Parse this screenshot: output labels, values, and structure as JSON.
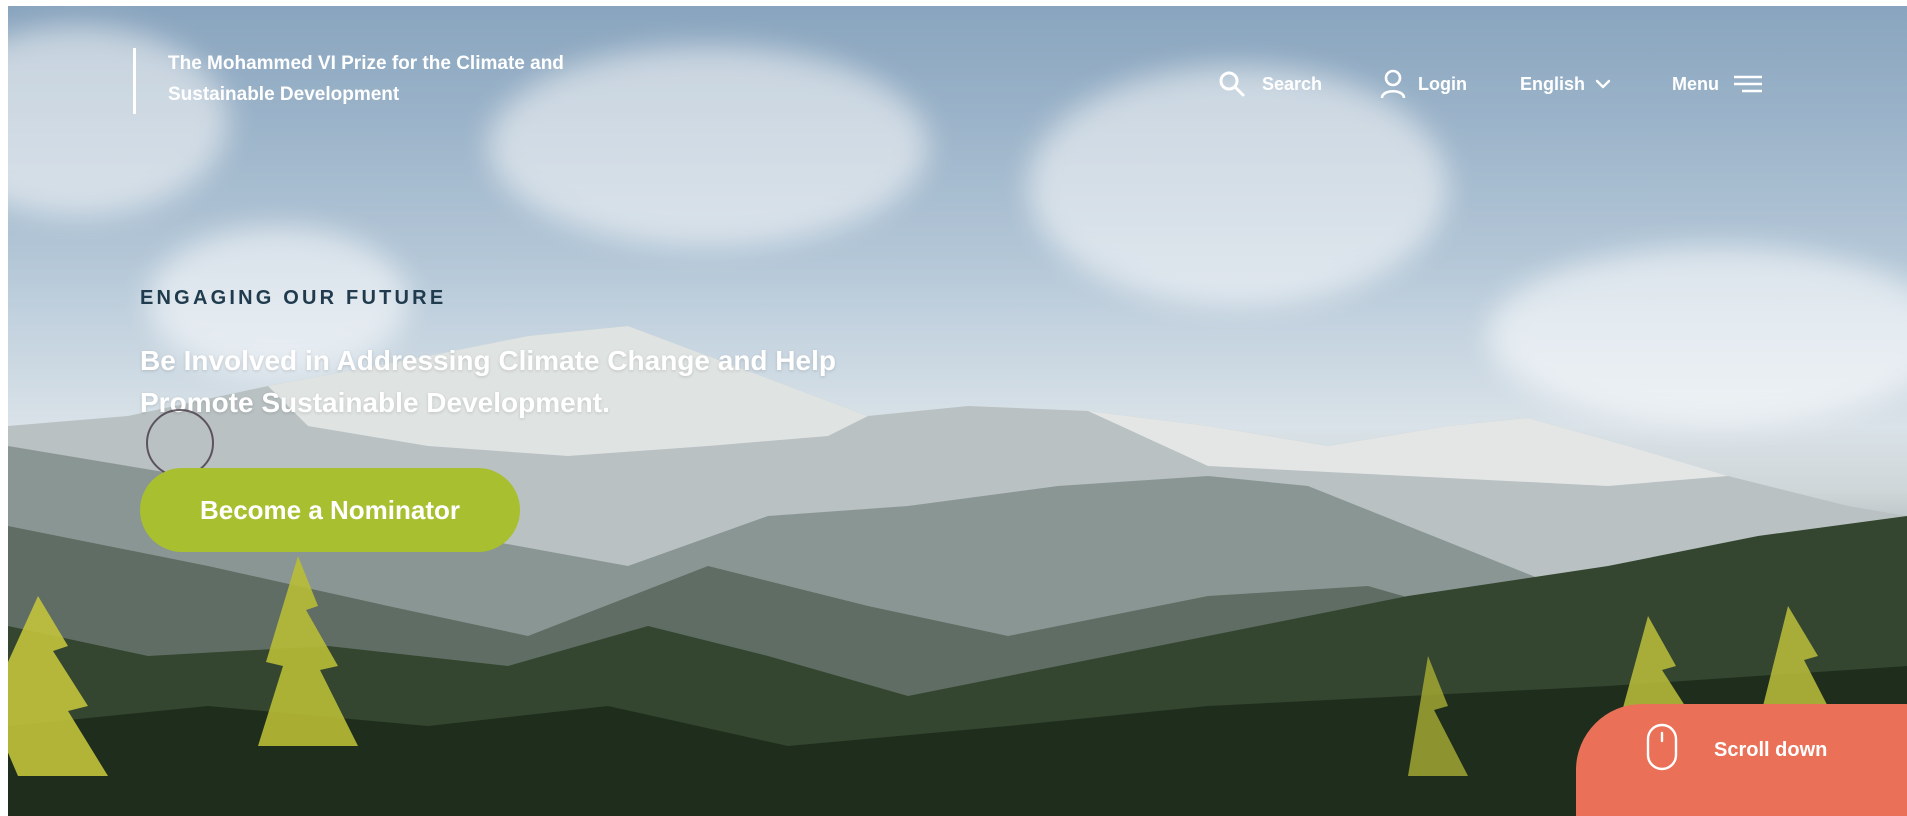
{
  "header": {
    "brand_line1": "The Mohammed VI Prize for the Climate and",
    "brand_line2": "Sustainable Development"
  },
  "nav": {
    "search": {
      "label": "Search",
      "icon": "search-icon"
    },
    "login": {
      "label": "Login",
      "icon": "user-icon"
    },
    "language": {
      "label": "English",
      "icon": "chevron-down-icon"
    },
    "menu": {
      "label": "Menu",
      "icon": "hamburger-icon"
    }
  },
  "hero": {
    "eyebrow": "ENGAGING OUR FUTURE",
    "headline_line1": "Be Involved in Addressing Climate Change and Help",
    "headline_line2": "Promote Sustainable Development.",
    "cta_label": "Become a Nominator"
  },
  "scroll": {
    "label": "Scroll down",
    "icon": "mouse-icon"
  },
  "colors": {
    "cta": "#a8bf2f",
    "scroll_badge": "#ea7158",
    "eyebrow": "#1f3b4d",
    "text_light": "#ffffff"
  }
}
